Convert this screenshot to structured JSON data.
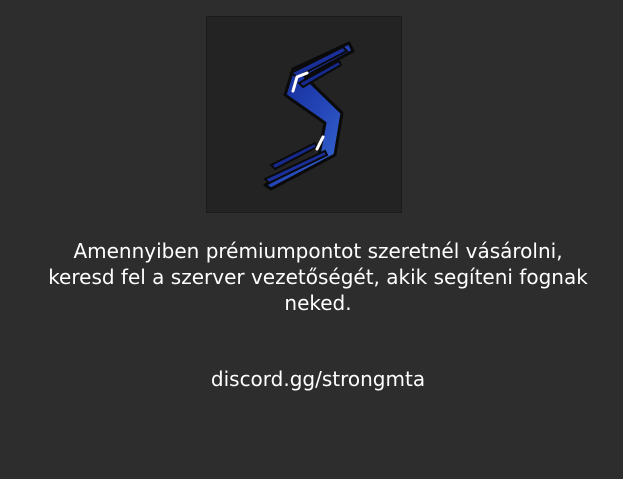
{
  "colors": {
    "background": "#2d2d2d",
    "logo_box": "#232323",
    "text": "#ffffff",
    "logo_blue_dark": "#0e1f88",
    "logo_blue_light": "#3d72d6"
  },
  "logo": {
    "icon": "stylized-s-logo-icon"
  },
  "message": {
    "text": "Amennyiben prémiumpontot szeretnél vásárolni,\nkeresd  fel a szerver vezetőségét, akik segíteni fognak\nneked."
  },
  "discord": {
    "link": "discord.gg/strongmta"
  }
}
